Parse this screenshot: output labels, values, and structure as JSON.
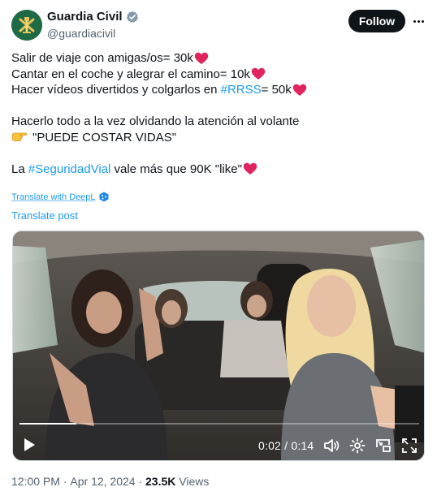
{
  "author": {
    "display_name": "Guardia Civil",
    "handle": "@guardiacivil",
    "avatar_icon": "guardia-civil-emblem-icon",
    "verified_icon": "verified-badge-icon"
  },
  "actions": {
    "follow_label": "Follow",
    "more_icon": "more-horizontal-icon"
  },
  "tweet": {
    "line1_text": "Salir de viaje con amigas/os= 30k",
    "line2_text": "Cantar en el coche y alegrar el camino= 10k",
    "line3_prefix": "Hacer vídeos divertidos y colgarlos en ",
    "line3_hashtag": "#RRSS",
    "line3_suffix": "= 50k",
    "line4_text": "Hacerlo todo a la vez olvidando la atención al volante",
    "line5_text": "\"PUEDE COSTAR VIDAS\"",
    "line6_prefix": "La ",
    "line6_hashtag": "#SeguridadVial",
    "line6_suffix": " vale más que 90K \"like\"",
    "heart_icon": "red-heart-icon",
    "point_icon": "backhand-index-pointing-right-icon"
  },
  "translation": {
    "deepl_label": "Translate with DeepL",
    "deepl_icon": "deepl-logo-icon",
    "post_label": "Translate post"
  },
  "video": {
    "current_time": "0:02",
    "separator": " / ",
    "duration": "0:14",
    "progress_fraction": 0.143,
    "icons": [
      "play-icon",
      "volume-icon",
      "settings-icon",
      "picture-in-picture-icon",
      "fullscreen-icon"
    ]
  },
  "meta": {
    "time": "12:00 PM",
    "separator": " · ",
    "date": "Apr 12, 2024",
    "views_count": "23.5K",
    "views_label": " Views"
  },
  "colors": {
    "accent": "#1d9bf0",
    "text": "#0f1419",
    "muted": "#536471",
    "heart": "#e0245e"
  }
}
